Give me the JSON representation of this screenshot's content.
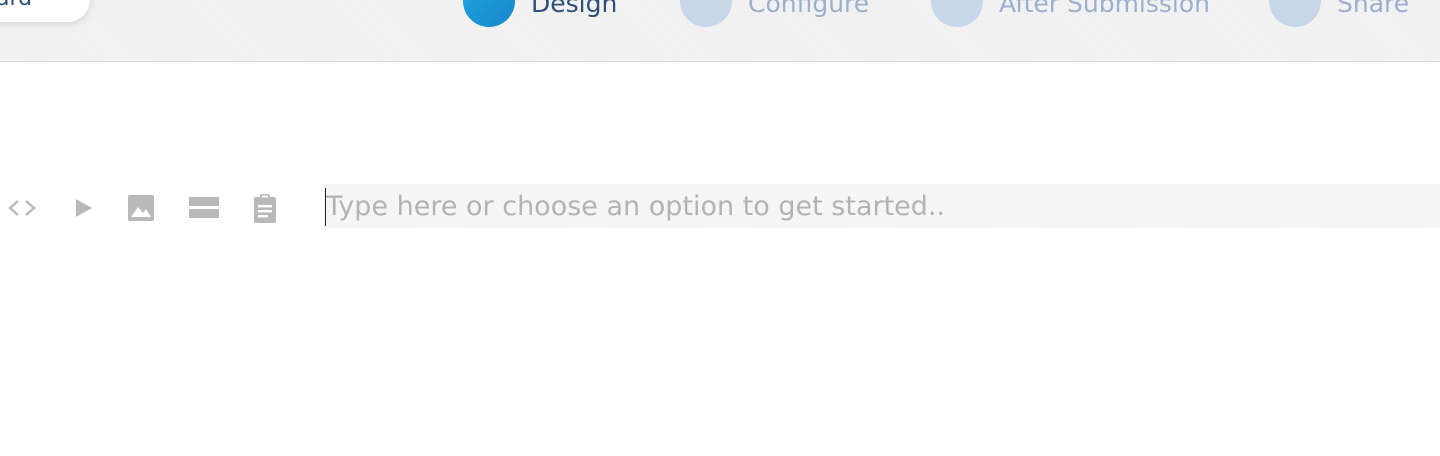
{
  "header": {
    "back_button_label": "ard",
    "steps": [
      {
        "label": "Design",
        "active": true
      },
      {
        "label": "Configure",
        "active": false
      },
      {
        "label": "After Submission",
        "active": false
      },
      {
        "label": "Share",
        "active": false
      }
    ]
  },
  "toolbar": {
    "icons": [
      "code-icon",
      "play-icon",
      "image-icon",
      "divider-icon",
      "clipboard-icon"
    ]
  },
  "editor": {
    "placeholder": "Type here or choose an option to get started..",
    "value": ""
  },
  "colors": {
    "accent": "#1a94d6",
    "step_active_text": "#2e4f7a",
    "step_inactive_text": "#9bb0cf",
    "step_inactive_dot": "#c8d6ea",
    "icon_gray": "#b9b9b9",
    "placeholder_gray": "#b3b3b3"
  }
}
